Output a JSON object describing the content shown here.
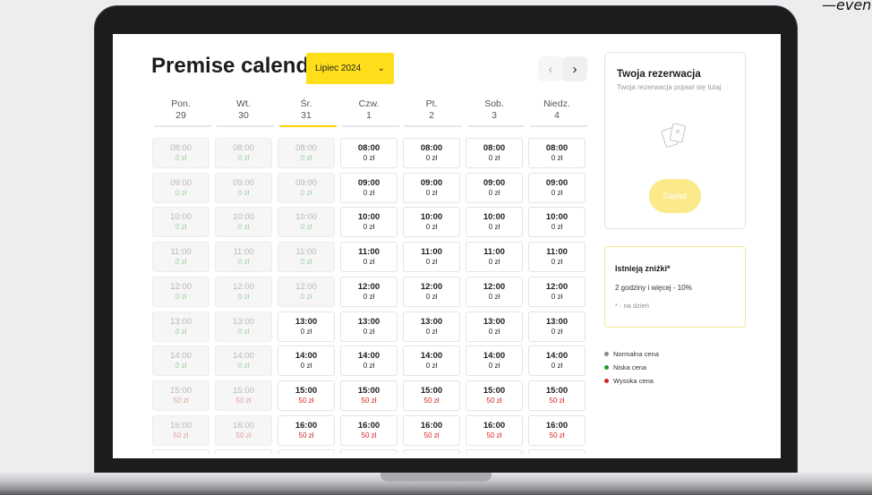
{
  "brand": "—even",
  "colors": {
    "accent": "#ffdf1b",
    "low": "#1f9d2a",
    "normal": "#8a8a8a",
    "high": "#d42727"
  },
  "calendar": {
    "title": "Premise calendar",
    "month": "Lipiec 2024",
    "prev_icon": "‹",
    "next_icon": "›",
    "days": [
      {
        "name": "Pon.",
        "date": "29"
      },
      {
        "name": "Wt.",
        "date": "30"
      },
      {
        "name": "Śr.",
        "date": "31"
      },
      {
        "name": "Czw.",
        "date": "1"
      },
      {
        "name": "Pt.",
        "date": "2"
      },
      {
        "name": "Sob.",
        "date": "3"
      },
      {
        "name": "Niedz.",
        "date": "4"
      }
    ],
    "today_index": 2,
    "times": [
      "08:00",
      "09:00",
      "10:00",
      "11:00",
      "12:00",
      "13:00",
      "14:00",
      "15:00",
      "16:00"
    ],
    "prices": [
      "0 zł",
      "0 zł",
      "0 zł",
      "0 zł",
      "0 zł",
      "0 zł",
      "0 zł",
      "50 zł",
      "50 zł"
    ],
    "price_level": [
      "normal",
      "normal",
      "normal",
      "normal",
      "normal",
      "normal",
      "normal",
      "high",
      "high"
    ],
    "past_first_available_row": [
      9,
      9,
      5,
      0,
      0,
      0,
      0
    ]
  },
  "reservation": {
    "title": "Twoja rezerwacja",
    "subtitle": "Twoja rezerwacja pojawi się tutaj",
    "pay_label": "Zapłać",
    "icon": "cards-icon"
  },
  "discounts": {
    "title": "Istnieją zniżki*",
    "line": "2 godziny i więcej - 10%",
    "note": "* - na dzień"
  },
  "legend": [
    {
      "label": "Normalna cena",
      "color": "#8a8a8a"
    },
    {
      "label": "Niska cena",
      "color": "#1f9d2a"
    },
    {
      "label": "Wysoka cena",
      "color": "#d42727"
    }
  ]
}
